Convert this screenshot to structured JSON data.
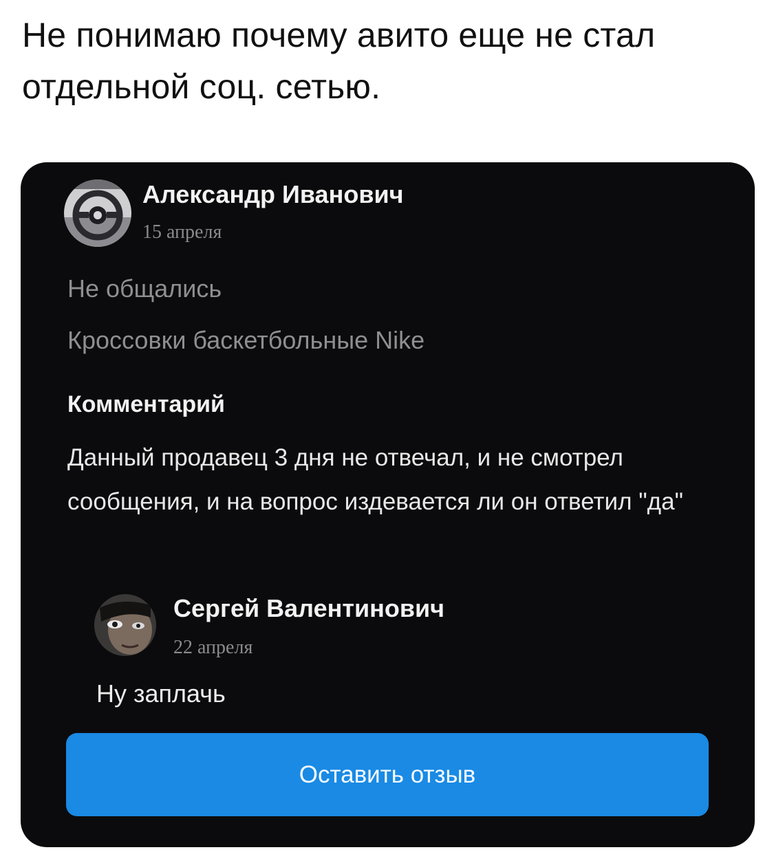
{
  "post": {
    "text": "Не понимаю почему авито еще не стал отдельной соц. сетью."
  },
  "review": {
    "author": {
      "name": "Александр Иванович",
      "date": "15 апреля",
      "avatar_icon": "avatar-steering-wheel-icon"
    },
    "deal_status": "Не общались",
    "item_title": "Кроссовки баскетбольные Nike",
    "comment_label": "Комментарий",
    "comment_text": "Данный продавец 3 дня не отвечал, и не смотрел сообщения, и на вопрос издевается ли он ответил \"да\""
  },
  "reply": {
    "author": {
      "name": "Сергей Валентинович",
      "date": "22 апреля",
      "avatar_icon": "avatar-face-icon"
    },
    "text": "Ну заплачь"
  },
  "actions": {
    "leave_review_label": "Оставить отзыв"
  },
  "colors": {
    "card_background": "#0b0b0d",
    "button_accent": "#1a8ae4",
    "muted_text": "#8e8e93",
    "page_background": "#ffffff"
  }
}
